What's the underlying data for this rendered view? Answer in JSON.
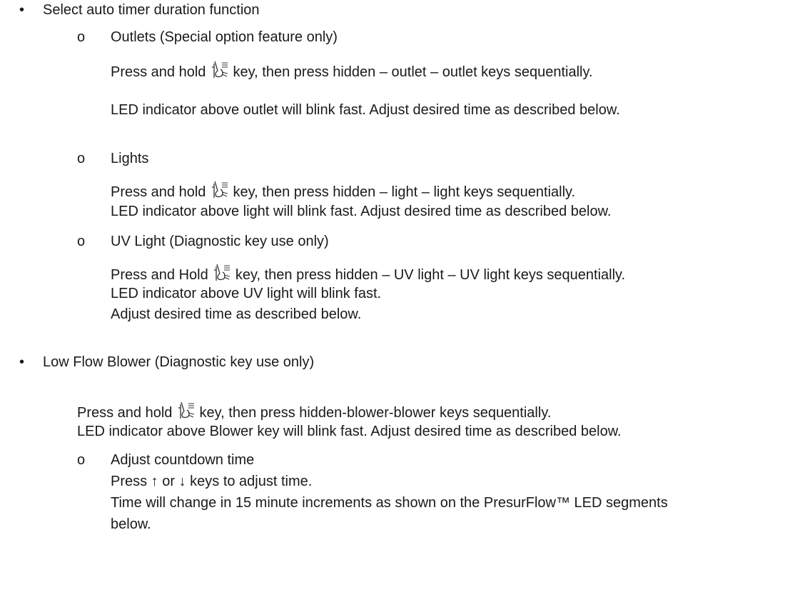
{
  "bullet_symbol": "•",
  "sub_bullet_symbol": "o",
  "section1": {
    "heading": "Select auto timer duration function",
    "outlets": {
      "title": "Outlets  (Special option feature only)",
      "line1_before": "Press and hold",
      "line1_after": "key, then press hidden – outlet – outlet keys sequentially.",
      "line2": "LED indicator above outlet will blink fast.  Adjust desired time as described below."
    },
    "lights": {
      "title": "Lights",
      "line1_before": "Press and hold",
      "line1_after": "key, then press hidden – light – light keys sequentially.",
      "line2": "LED indicator above light will blink fast.  Adjust desired time as described below."
    },
    "uv": {
      "title": "UV Light (Diagnostic key use only)",
      "line1_before": "Press and Hold",
      "line1_after": "key, then press hidden – UV light – UV light keys sequentially.",
      "line2": "LED indicator above UV light will blink fast.",
      "line3": "Adjust desired time as described below."
    }
  },
  "section2": {
    "heading": "Low Flow Blower (Diagnostic key use only)",
    "line1_before": "Press and hold",
    "line1_after": "key, then press hidden-blower-blower keys sequentially.",
    "line2": "LED indicator above Blower key will blink fast.  Adjust desired time as described below.",
    "adjust": {
      "title": "Adjust countdown time",
      "line1": "Press ↑ or ↓ keys to adjust time.",
      "line2": "Time will change in 15 minute increments as shown on the PresurFlow™ LED segments",
      "line3": "below."
    }
  },
  "icon": "light-key-icon"
}
